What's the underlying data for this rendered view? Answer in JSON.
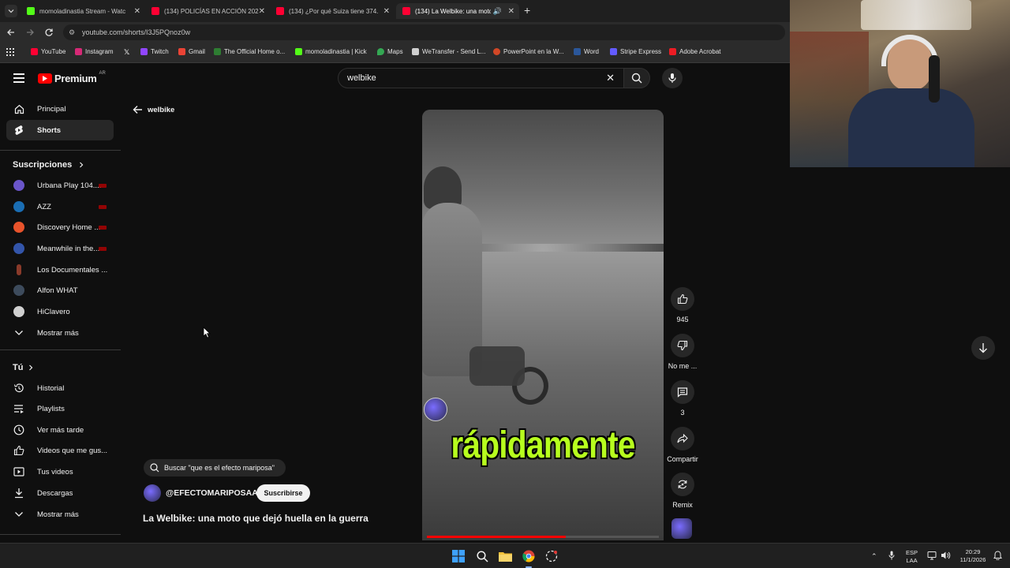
{
  "browser": {
    "tabs": [
      {
        "title": "momoladinastia Stream - Watc",
        "active": false,
        "favicon_color": "#53fc18"
      },
      {
        "title": "(134) POLICÍAS EN ACCIÓN 202",
        "active": false,
        "favicon_color": "#ff0033"
      },
      {
        "title": "(134) ¿Por qué Suiza tiene 374.",
        "active": false,
        "favicon_color": "#ff0033"
      },
      {
        "title": "(134) La Welbike: una moto",
        "active": true,
        "favicon_color": "#ff0033"
      }
    ],
    "url": "youtube.com/shorts/I3J5PQnoz0w",
    "bookmarks": [
      {
        "label": "YouTube",
        "color": "#ff0033"
      },
      {
        "label": "Instagram",
        "color": "#d62976"
      },
      {
        "label": "",
        "color": "#e7e7e7"
      },
      {
        "label": "Twitch",
        "color": "#9146ff"
      },
      {
        "label": "Gmail",
        "color": "#ea4335"
      },
      {
        "label": "The Official Home o...",
        "color": "#2e7d32"
      },
      {
        "label": "momoladinastia | Kick",
        "color": "#53fc18"
      },
      {
        "label": "Maps",
        "color": "#34a853"
      },
      {
        "label": "WeTransfer - Send L...",
        "color": "#cfcfcf"
      },
      {
        "label": "PowerPoint en la W...",
        "color": "#d24726"
      },
      {
        "label": "Word",
        "color": "#2b579a"
      },
      {
        "label": "Stripe Express",
        "color": "#635bff"
      },
      {
        "label": "Adobe Acrobat",
        "color": "#ec1c24"
      }
    ]
  },
  "header": {
    "logo_text": "Premium",
    "region": "AR",
    "search_value": "welbike"
  },
  "sidebar": {
    "main": [
      {
        "label": "Principal",
        "icon": "home-icon"
      },
      {
        "label": "Shorts",
        "icon": "shorts-icon"
      }
    ],
    "subscriptions_title": "Suscripciones",
    "subscriptions": [
      {
        "label": "Urbana Play 104....",
        "live": true,
        "color": "#6a55c9"
      },
      {
        "label": "AZZ",
        "live": true,
        "color": "#1a6db3"
      },
      {
        "label": "Discovery Home ...",
        "live": true,
        "color": "#e8532b"
      },
      {
        "label": "Meanwhile in the...",
        "live": true,
        "color": "#3355aa"
      },
      {
        "label": "Los Documentales ...",
        "live": false,
        "color": "#8a3a2a"
      },
      {
        "label": "Alfon WHAT",
        "live": false,
        "color": "#3d4b5c"
      },
      {
        "label": "HiClavero",
        "live": false,
        "color": "#d0d0d0"
      }
    ],
    "show_more_1": "Mostrar más",
    "you_title": "Tú",
    "you_items": [
      {
        "label": "Historial",
        "icon": "history-icon"
      },
      {
        "label": "Playlists",
        "icon": "playlists-icon"
      },
      {
        "label": "Ver más tarde",
        "icon": "watch-later-icon"
      },
      {
        "label": "Videos que me gus...",
        "icon": "liked-icon"
      },
      {
        "label": "Tus videos",
        "icon": "your-videos-icon"
      },
      {
        "label": "Descargas",
        "icon": "downloads-icon"
      }
    ],
    "show_more_2": "Mostrar más"
  },
  "page": {
    "back_label": "welbike"
  },
  "video": {
    "caption": "rápidamente",
    "progress": 0.6,
    "actions": {
      "likes": "945",
      "dislike": "No me ...",
      "comments": "3",
      "share": "Compartir",
      "remix": "Remix"
    },
    "related_search": "Buscar \"que es el efecto mariposa\"",
    "channel": "@EFECTOMARIPOSAA",
    "subscribe_label": "Suscribirse",
    "title": "La Welbike: una moto que dejó huella en la guerra"
  },
  "taskbar": {
    "lang_1": "ESP",
    "lang_2": "LAA",
    "time": "20:29",
    "date": "11/1/2026"
  },
  "colors": {
    "accent_red": "#ff0000",
    "caption_green": "#b7ff1e",
    "background": "#0f0f0f"
  }
}
